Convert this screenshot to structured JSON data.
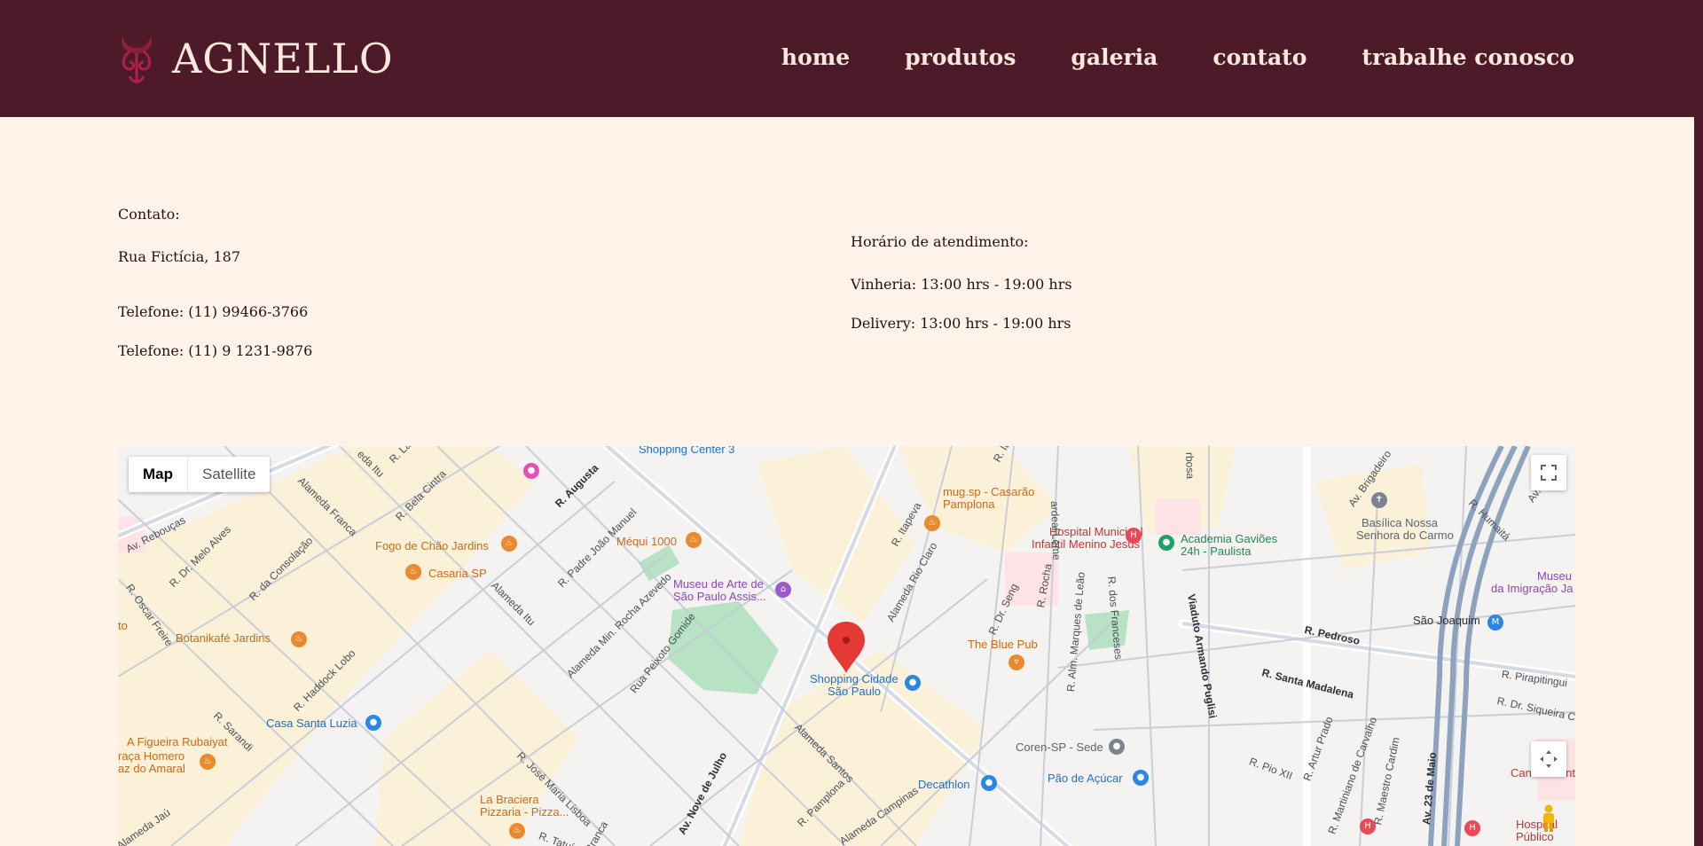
{
  "brand": {
    "name": "AGNELLO"
  },
  "nav": [
    "home",
    "produtos",
    "galeria",
    "contato",
    "trabalhe conosco"
  ],
  "contact": {
    "heading": "Contato:",
    "address": "Rua Fictícia, 187",
    "phone1": "Telefone: (11) 99466-3766",
    "phone2": "Telefone: (11) 9 1231-9876"
  },
  "hours": {
    "heading": "Horário de atendimento:",
    "wine": "Vinheria: 13:00 hrs - 19:00 hrs",
    "delivery": "Delivery: 13:00 hrs - 19:00 hrs"
  },
  "map": {
    "tab_map": "Map",
    "tab_satellite": "Satellite",
    "places": [
      "Shopping Center 3",
      "mug.sp - Casarão",
      "Pamplona",
      "Hospital Municipal",
      "Infantil Menino Jesus",
      "Academia Gaviões",
      "24h - Paulista",
      "Basílica Nossa",
      "Senhora do Carmo",
      "Museu",
      "da Imigração Ja",
      "Fogo de Chão Jardins",
      "Méqui 1000",
      "Casaria SP",
      "Museu de Arte de",
      "São Paulo Assis...",
      "São Joaquim",
      "Botanikafé Jardins",
      "The Blue Pub",
      "Shopping Cidade",
      "São Paulo",
      "Casa Santa Luzia",
      "A Figueira Rubaiyat",
      "raça Homero",
      "az do Amaral",
      "Coren-SP - Sede",
      "Pão de Açúcar",
      "Decathlon",
      "La Braciera",
      "Pizzaria - Pizza...",
      "Hospital",
      "Público",
      "Cancer Cent",
      "to"
    ],
    "streets": [
      "Av. Rebouças",
      "R. Dr. Melo Alves",
      "R. Oscar Freire",
      "R. da Consolação",
      "Alameda Franca",
      "R. Bela Cintra",
      "R. Augusta",
      "R. Padre João Manuel",
      "Alameda Itu",
      "Alameda Min. Rocha Azevedo",
      "Rua Peixoto Gomide",
      "R. Haddock Lobo",
      "R. Sarandi",
      "R. José Maria Lisboa",
      "Av. Nove de Julho",
      "Alameda Santos",
      "R. Pamplona",
      "Alameda Campinas",
      "Alameda Rio Claro",
      "R. Itapeva",
      "R. Dr. Seng",
      "R. Rocha",
      "R. Alm. Marques de Leão",
      "R. dos Franceses",
      "Viaduto Armando Puglisi",
      "R. Pedroso",
      "R. Santa Madalena",
      "R. Artur Prado",
      "R. Martiniano de Carvalho",
      "R. Maestro Cardim",
      "Av. 23 de Maio",
      "R. Humaitá",
      "Av. Brigadeiro",
      "R. Pirapitingui",
      "R. Dr. Siqueira C",
      "R. Pio XII",
      "R. Tatuí",
      "Branca",
      "Alameda Jaú",
      "ardeal Leme",
      "rbosa",
      "R. Ita",
      "eda Itu",
      "R. Lac",
      "Av. da"
    ]
  }
}
